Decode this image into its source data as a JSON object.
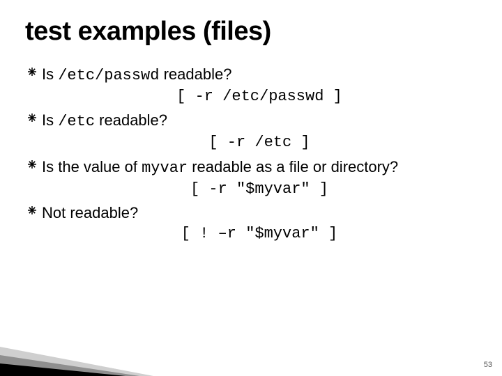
{
  "title": "test examples (files)",
  "items": [
    {
      "q_pre": "Is ",
      "q_code": "/etc/passwd",
      "q_post": " readable?",
      "code": "[ -r /etc/passwd ]"
    },
    {
      "q_pre": "Is ",
      "q_code": "/etc",
      "q_post": " readable?",
      "code": "[ -r /etc ]"
    },
    {
      "q_pre": "Is the value of ",
      "q_code": "myvar",
      "q_post": " readable as a file or directory?",
      "code": "[ -r \"$myvar\" ]"
    },
    {
      "q_pre": "Not readable?",
      "q_code": "",
      "q_post": "",
      "code": "[ ! –r \"$myvar\" ]"
    }
  ],
  "page_number": "53"
}
